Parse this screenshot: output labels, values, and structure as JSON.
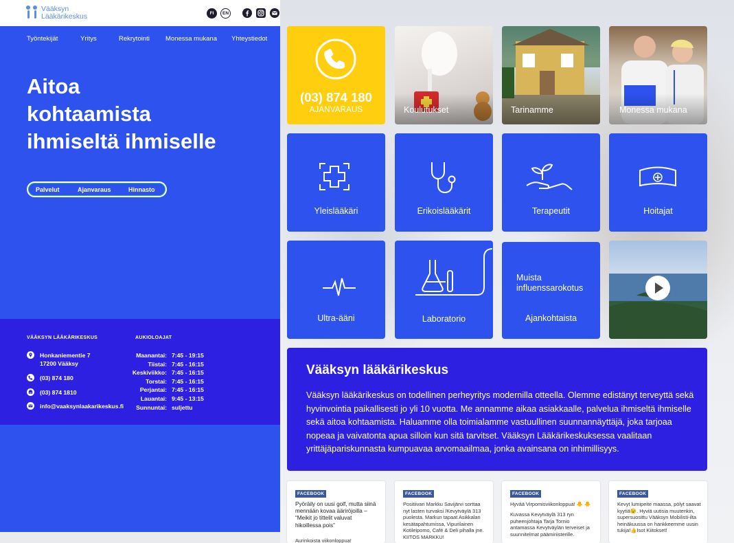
{
  "brand": {
    "logo_line1": "Vääksyn",
    "logo_line2": "Lääkärikeskus"
  },
  "languages": [
    "FI",
    "EN"
  ],
  "social_icons": [
    "facebook-icon",
    "instagram-icon",
    "email-icon"
  ],
  "main_nav": [
    "Työntekijät",
    "Yritys",
    "Rekrytointi",
    "Monessa mukana",
    "Yhteystiedot"
  ],
  "hero": {
    "line1": "Aitoa",
    "line2": "kohtaamista",
    "line3": "ihmiseltä ihmiselle"
  },
  "pill_nav": [
    "Palvelut",
    "Ajanvaraus",
    "Hinnasto"
  ],
  "info": {
    "company_heading": "VÄÄKSYN LÄÄKÄRIKESKUS",
    "hours_heading": "AUKIOLOAJAT",
    "address_line1": "Honkaniementie 7",
    "address_line2": "17200 Vääksy",
    "phone": "(03) 874 180",
    "fax": "(03) 874 1810",
    "email": "info@vaaksynlaakarikeskus.fi",
    "hours": [
      {
        "day": "Maanantai:",
        "time": "7:45 - 19:15"
      },
      {
        "day": "Tiistai:",
        "time": "7:45 - 16:15"
      },
      {
        "day": "Keskiviikko:",
        "time": "7:45 - 16:15"
      },
      {
        "day": "Torstai:",
        "time": "7:45 - 16:15"
      },
      {
        "day": "Perjantai:",
        "time": "7:45 - 16:15"
      },
      {
        "day": "Lauantai:",
        "time": "9:45 - 13:15"
      },
      {
        "day": "Sunnuntai:",
        "time": "suljettu"
      }
    ]
  },
  "booking": {
    "number": "(03) 874 180",
    "label": "AJANVARAUS"
  },
  "photo_tiles": [
    "Koulutukset",
    "Tarinamme",
    "Monessa mukana"
  ],
  "service_tiles": [
    "Yleislääkäri",
    "Erikoislääkärit",
    "Terapeutit",
    "Hoitajat",
    "Ultra-ääni",
    "Laboratorio"
  ],
  "news_tile": {
    "text": "Muista influenssarokotus",
    "label": "Ajankohtaista"
  },
  "about": {
    "title": "Vääksyn lääkärikeskus",
    "body": "Vääksyn lääkärikeskus on todellinen perheyritys modernilla otteella. Olemme edistänyt terveyttä sekä hyvinvointia paikallisesti jo yli 10 vuotta. Me annamme aikaa asiakkaalle, palvelua ihmiseltä ihmiselle sekä aitoa kohtaamista. Haluamme olla toimialamme vastuullinen suunnannäyttäjä, joka tarjoaa nopeaa ja vaivatonta apua silloin kun sitä tarvitset. Vääksyn Lääkärikeskuksessa vaalitaan yrittäjäpariskunnasta kumpuavaa arvomaailmaa, jonka avainsana on inhimillisyys."
  },
  "facebook_posts": [
    {
      "tag": "FACEBOOK",
      "text": "Pyöräily on uusi golf, mutta siinä mennään kovaa ääriröjoilla – “Meikit jo tittelit valuvat hikoillessa pois”",
      "extra": "Aurinkoista viikonloppua!"
    },
    {
      "tag": "FACEBOOK",
      "text": "Positiivari Markku Savijärvi sorttaa nyt lasten turvaksi /Kevytväylä 313 puolesta. Markun tapaat Asikkalan kesätapahtumissa, Vipurilainen Kotileipomo, Café & Deli pihalla jne. KIITOS MARKKU!"
    },
    {
      "tag": "FACEBOOK",
      "text": "Hyvää Virpomisviikonloppua! 🐥 🐥",
      "extra": "Kuvassa Kevytväylä 313 ryn puheenjohtaja Tarja Tornio antamassa Kevytväylän terveiset ja suunnitelmat päämiriisterille."
    },
    {
      "tag": "FACEBOOK",
      "text": "Kevyt lumipeite maassa, pölyt saavat kyytiä😉. Hyviä uutisia muutenkin, supersuosittu Vääksyn Mobilisti-ilta heinäkuussa on hankkeemme uusin tukija!👍Isot Kiitokset!"
    }
  ],
  "colors": {
    "primary": "#2e52ee",
    "dark_blue": "#2d20e0",
    "yellow": "#ffcf0f",
    "facebook": "#3b5998"
  }
}
